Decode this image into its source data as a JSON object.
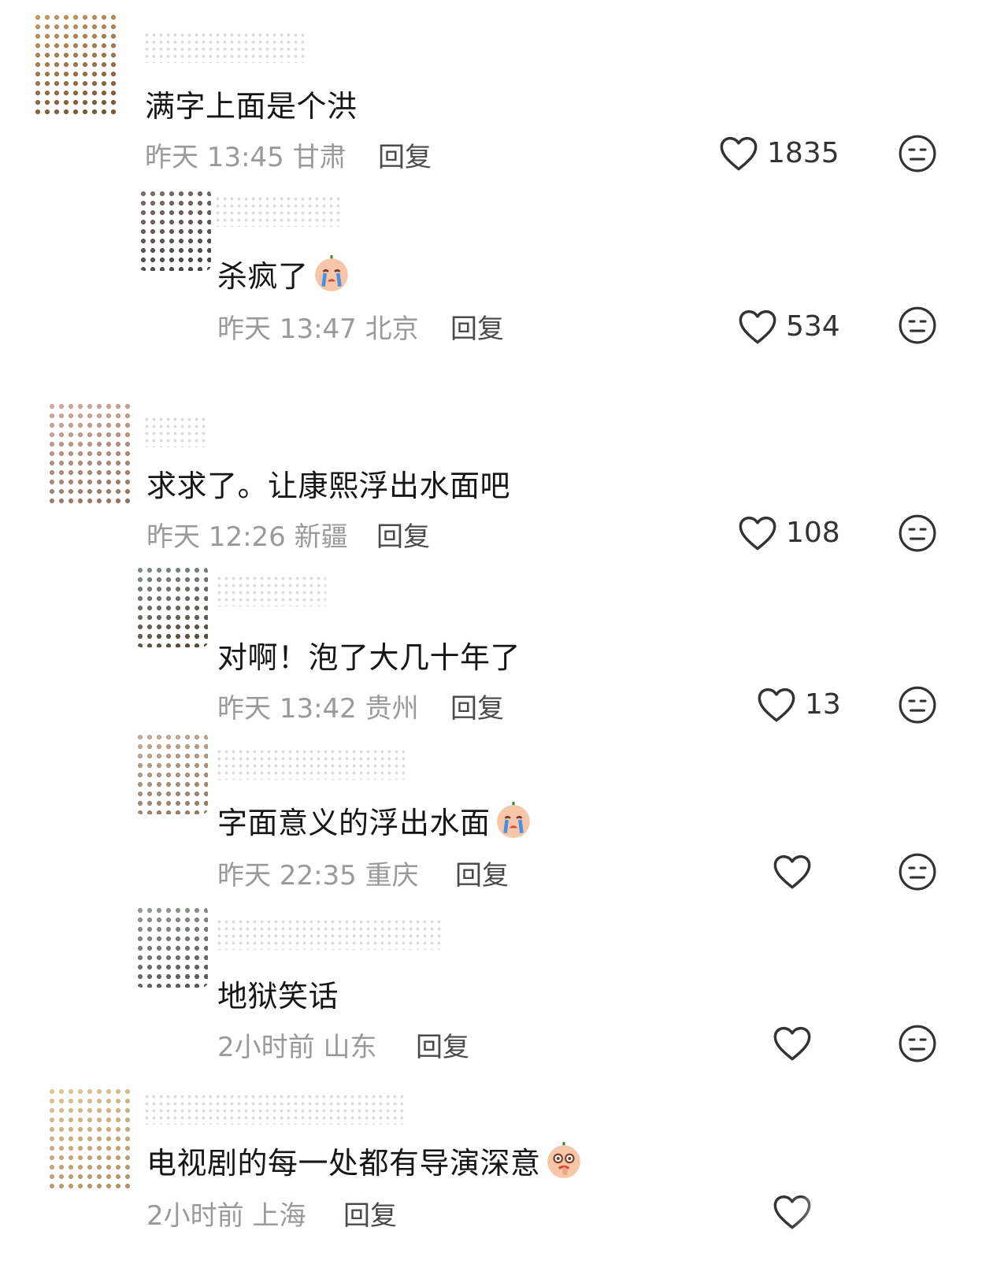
{
  "comments": [
    {
      "text": "满字上面是个洪",
      "time": "昨天 13:45",
      "location": "甘肃",
      "reply": "回复",
      "likes": "1835",
      "avatar_colors": [
        "#c89558",
        "#6b4a2a"
      ]
    },
    {
      "text": "杀疯了",
      "time": "昨天 13:47",
      "location": "北京",
      "reply": "回复",
      "likes": "534",
      "avatar_colors": [
        "#7a6a66",
        "#3a3a3a"
      ],
      "emoji": "crying-face"
    },
    {
      "text": "求求了。让康熙浮出水面吧",
      "time": "昨天 12:26",
      "location": "新疆",
      "reply": "回复",
      "likes": "108",
      "avatar_colors": [
        "#d6a89a",
        "#8a6a5a"
      ]
    },
    {
      "text": "对啊！泡了大几十年了",
      "time": "昨天 13:42",
      "location": "贵州",
      "reply": "回复",
      "likes": "13",
      "avatar_colors": [
        "#7a8a8a",
        "#4b3b2b"
      ]
    },
    {
      "text": "字面意义的浮出水面",
      "time": "昨天 22:35",
      "location": "重庆",
      "reply": "回复",
      "likes": "",
      "avatar_colors": [
        "#c8a890",
        "#8a7060"
      ],
      "emoji": "crying-face"
    },
    {
      "text": "地狱笑话",
      "time": "2小时前",
      "location": "山东",
      "reply": "回复",
      "likes": "",
      "avatar_colors": [
        "#909a90",
        "#4a4a4a"
      ]
    },
    {
      "text": "电视剧的每一处都有导演深意",
      "time": "2小时前",
      "location": "上海",
      "reply": "回复",
      "likes": "",
      "avatar_colors": [
        "#e0c890",
        "#b08a60"
      ],
      "emoji": "thinking-face"
    }
  ],
  "icons": {
    "like": "heart-outline-icon",
    "dislike": "neutral-face-icon"
  },
  "colors": {
    "text": "#161616",
    "meta": "#9a9a9a",
    "reply": "#4a4a4a",
    "icon": "#333333"
  }
}
